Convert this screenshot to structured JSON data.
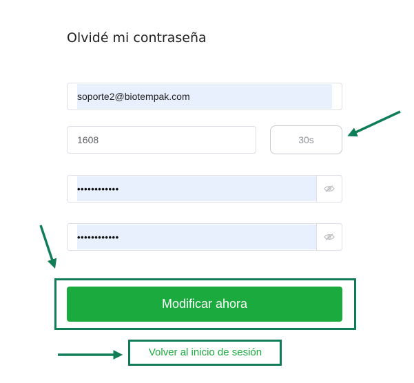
{
  "page": {
    "title": "Olvidé mi contraseña"
  },
  "form": {
    "email_value": "soporte2@biotempak.com",
    "code_value": "1608",
    "code_button_label": "30s",
    "password_mask": "••••••••••••",
    "confirm_password_mask": "••••••••••••",
    "submit_label": "Modificar ahora",
    "back_link_label": "Volver al inicio de sesión"
  },
  "colors": {
    "accent": "#1aaa3e",
    "annotation": "#0f7d55",
    "autofill": "#e8f0fe"
  },
  "icons": {
    "password_toggle": "eye-hidden-icon",
    "confirm_password_toggle": "eye-hidden-icon"
  }
}
